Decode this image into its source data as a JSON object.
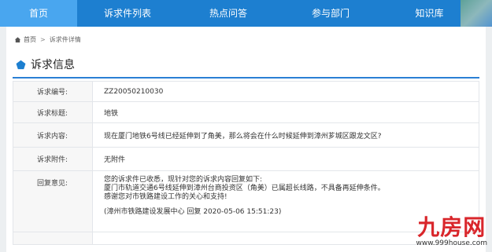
{
  "nav": {
    "items": [
      {
        "label": "首页",
        "active": true
      },
      {
        "label": "诉求件列表",
        "active": false
      },
      {
        "label": "热点问答",
        "active": false
      },
      {
        "label": "参与部门",
        "active": false
      },
      {
        "label": "知识库",
        "active": false
      }
    ]
  },
  "breadcrumb": {
    "home": "首页",
    "separator": ">",
    "current": "诉求件详情"
  },
  "page": {
    "title": "诉求信息",
    "title_icon": "pentagon-icon",
    "accent_color": "#1d7fd0"
  },
  "info": {
    "rows": [
      {
        "label": "诉求编号:",
        "value": "ZZ20050210030"
      },
      {
        "label": "诉求标题:",
        "value": "地铁"
      },
      {
        "label": "诉求内容:",
        "value": "现在厦门地铁6号线已经延伸到了角美，那么将会在什么时候延伸到漳州芗城区跟龙文区?"
      },
      {
        "label": "诉求附件:",
        "value": "无附件"
      }
    ],
    "reply": {
      "label": "回复意见:",
      "lines": [
        "您的诉求件已收悉，现针对您的诉求内容回复如下:",
        "厦门市轨道交通6号线延伸到漳州台商投资区（角美）已属超长线路，不具备再延伸条件。",
        "感谢您对市铁路建设工作的关心和支持!"
      ],
      "signature": "(漳州市铁路建设发展中心 回复 2020-05-06 15:51:23)"
    }
  },
  "watermark": {
    "main": "九房网",
    "url": "www.999house.com"
  }
}
